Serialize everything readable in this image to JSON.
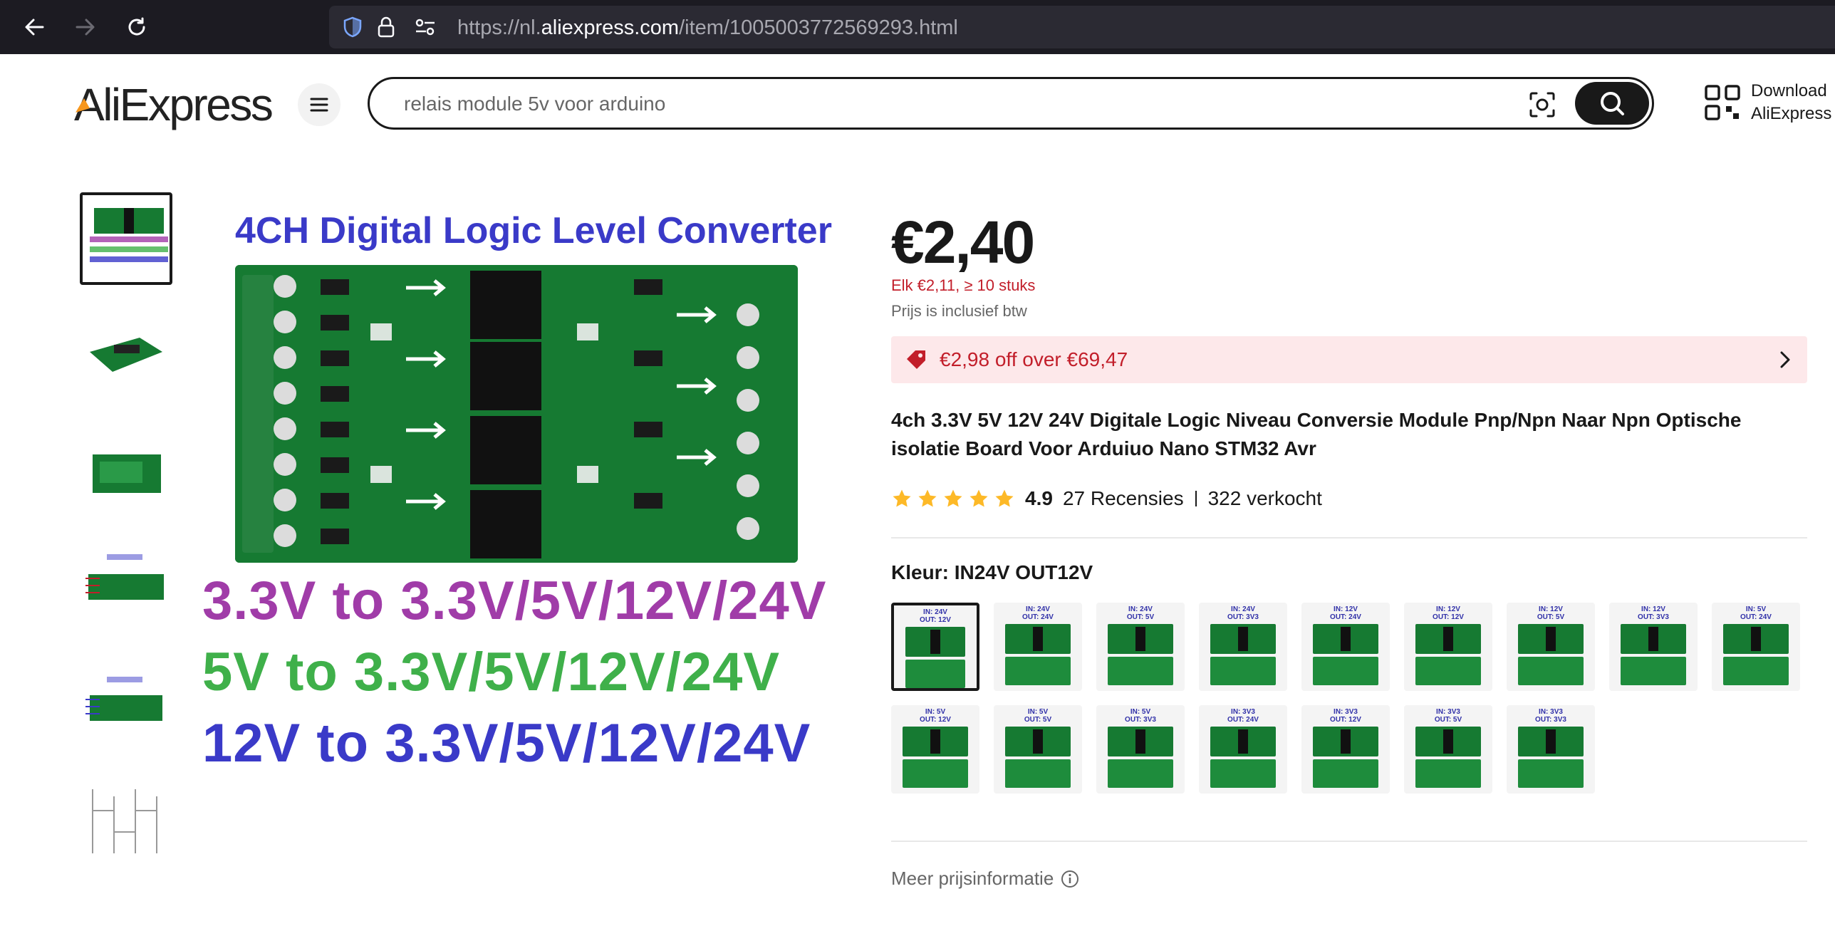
{
  "browser": {
    "url_prefix": "https://nl.",
    "url_host": "aliexpress.com",
    "url_path": "/item/1005003772569293.html"
  },
  "header": {
    "logo": "AliExpress",
    "search_value": "relais module 5v voor arduino",
    "download_line1": "Download",
    "download_line2": "AliExpress"
  },
  "gallery": {
    "main_title": "4CH Digital Logic Level Converter",
    "lines": [
      {
        "text": "3.3V to 3.3V/5V/12V/24V",
        "color": "#a03ca8"
      },
      {
        "text": "5V    to 3.3V/5V/12V/24V",
        "color": "#3fb04a"
      },
      {
        "text": "12V to 3.3V/5V/12V/24V",
        "color": "#3a3ac8"
      }
    ]
  },
  "product": {
    "price": "€2,40",
    "bulk_price": "Elk €2,11, ≥ 10 stuks",
    "vat_note": "Prijs is inclusief btw",
    "coupon": "€2,98 off over €69,47",
    "title": "4ch 3.3V 5V 12V 24V Digitale Logic Niveau Conversie Module Pnp/Npn Naar Npn Optische isolatie Board Voor Arduiuo Nano STM32 Avr",
    "rating": "4.9",
    "reviews": "27 Recensies",
    "sold": "322 verkocht",
    "color_label": "Kleur:",
    "color_value": "IN24V OUT12V",
    "variants": [
      "IN: 24V\nOUT: 12V",
      "IN: 24V\nOUT: 24V",
      "IN: 24V\nOUT: 5V",
      "IN: 24V\nOUT: 3V3",
      "IN: 12V\nOUT: 24V",
      "IN: 12V\nOUT: 12V",
      "IN: 12V\nOUT: 5V",
      "IN: 12V\nOUT: 3V3",
      "IN: 5V\nOUT: 24V",
      "IN: 5V\nOUT: 12V",
      "IN: 5V\nOUT: 5V",
      "IN: 5V\nOUT: 3V3",
      "IN: 3V3\nOUT: 24V",
      "IN: 3V3\nOUT: 12V",
      "IN: 3V3\nOUT: 5V",
      "IN: 3V3\nOUT: 3V3"
    ],
    "more_price_info": "Meer prijsinformatie"
  },
  "colors": {
    "accent": "#c21e2a",
    "star": "#fdb927",
    "board_green": "#167a32"
  }
}
